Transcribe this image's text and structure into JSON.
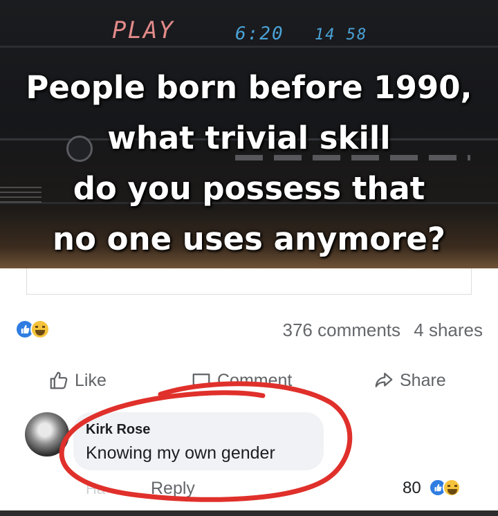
{
  "meme": {
    "display_play": "PLAY",
    "display_time": "6:20",
    "display_counter": "14 58",
    "caption_lines": [
      "People born before 1990,",
      "what trivial skill",
      "do you possess that",
      "no one uses anymore?"
    ]
  },
  "post": {
    "comments_count": "376 comments",
    "shares_count": "4 shares",
    "actions": {
      "like": "Like",
      "comment": "Comment",
      "share": "Share"
    }
  },
  "comment": {
    "author": "Kirk Rose",
    "text": "Knowing my own gender",
    "meta_ha": "Ha",
    "reply_label": "Reply",
    "reaction_count": "80"
  },
  "colors": {
    "like_blue": "#2f7de1",
    "haha_yellow": "#f5c33b",
    "annotation_red": "#e0302b",
    "caption_white": "#ffffff"
  },
  "icons": {
    "like_action": "thumbs-up-outline-icon",
    "comment_action": "speech-bubble-icon",
    "share_action": "share-arrow-icon",
    "reaction_like": "like-reaction-icon",
    "reaction_haha": "haha-reaction-icon"
  }
}
